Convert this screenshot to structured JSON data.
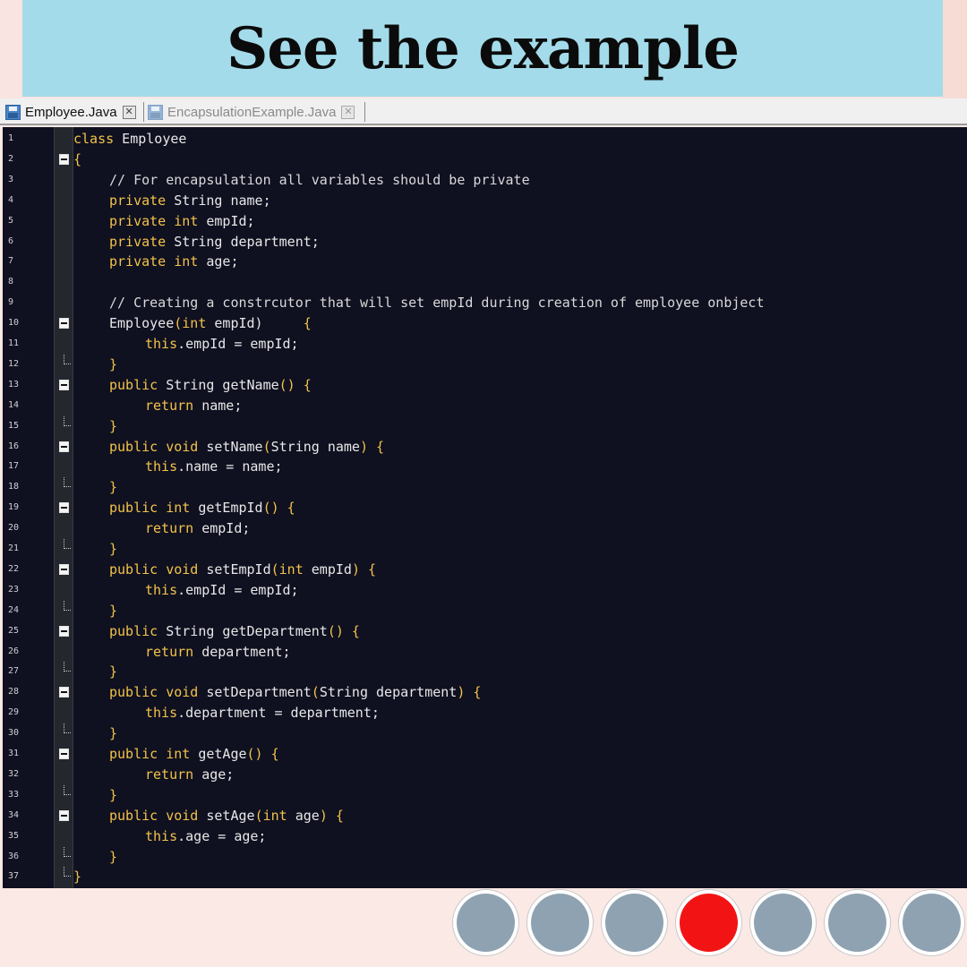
{
  "banner": {
    "title": "See the example"
  },
  "tabs": [
    {
      "label": "Employee.Java",
      "active": true
    },
    {
      "label": "EncapsulationExample.Java",
      "active": false
    }
  ],
  "editor": {
    "lines": [
      {
        "n": "1",
        "fold": "none",
        "indent": 0,
        "segs": [
          [
            "kw",
            "class"
          ],
          [
            "t",
            " Employee"
          ]
        ]
      },
      {
        "n": "2",
        "fold": "open",
        "indent": 0,
        "segs": [
          [
            "br",
            "{"
          ]
        ]
      },
      {
        "n": "3",
        "fold": "none",
        "indent": 1,
        "segs": [
          [
            "cm",
            "// For encapsulation all variables should be private"
          ]
        ]
      },
      {
        "n": "4",
        "fold": "none",
        "indent": 1,
        "segs": [
          [
            "kw",
            "private"
          ],
          [
            "t",
            " String name;"
          ]
        ]
      },
      {
        "n": "5",
        "fold": "none",
        "indent": 1,
        "segs": [
          [
            "kw",
            "private int"
          ],
          [
            "t",
            " empId;"
          ]
        ]
      },
      {
        "n": "6",
        "fold": "none",
        "indent": 1,
        "segs": [
          [
            "kw",
            "private"
          ],
          [
            "t",
            " String department;"
          ]
        ]
      },
      {
        "n": "7",
        "fold": "none",
        "indent": 1,
        "segs": [
          [
            "kw",
            "private int"
          ],
          [
            "t",
            " age;"
          ]
        ]
      },
      {
        "n": "8",
        "fold": "none",
        "indent": 1,
        "segs": []
      },
      {
        "n": "9",
        "fold": "none",
        "indent": 1,
        "segs": [
          [
            "cm",
            "// Creating a constrcutor that will set empId during creation of employee onbject"
          ]
        ]
      },
      {
        "n": "10",
        "fold": "open",
        "indent": 1,
        "segs": [
          [
            "t",
            "Employee"
          ],
          [
            "kw",
            "(int"
          ],
          [
            "t",
            " empId)"
          ],
          [
            "br",
            "     {"
          ]
        ]
      },
      {
        "n": "11",
        "fold": "none",
        "indent": 2,
        "segs": [
          [
            "kw",
            "this"
          ],
          [
            "t",
            ".empId = empId;"
          ]
        ]
      },
      {
        "n": "12",
        "fold": "end",
        "indent": 1,
        "segs": [
          [
            "br",
            "}"
          ]
        ]
      },
      {
        "n": "13",
        "fold": "open",
        "indent": 1,
        "segs": [
          [
            "kw",
            "public"
          ],
          [
            "t",
            " String getName"
          ],
          [
            "br",
            "() {"
          ]
        ]
      },
      {
        "n": "14",
        "fold": "none",
        "indent": 2,
        "segs": [
          [
            "kw",
            "return"
          ],
          [
            "t",
            " name;"
          ]
        ]
      },
      {
        "n": "15",
        "fold": "end",
        "indent": 1,
        "segs": [
          [
            "br",
            "}"
          ]
        ]
      },
      {
        "n": "16",
        "fold": "open",
        "indent": 1,
        "segs": [
          [
            "kw",
            "public void"
          ],
          [
            "t",
            " setName"
          ],
          [
            "br",
            "("
          ],
          [
            "t",
            "String name"
          ],
          [
            "br",
            ") {"
          ]
        ]
      },
      {
        "n": "17",
        "fold": "none",
        "indent": 2,
        "segs": [
          [
            "kw",
            "this"
          ],
          [
            "t",
            ".name = name;"
          ]
        ]
      },
      {
        "n": "18",
        "fold": "end",
        "indent": 1,
        "segs": [
          [
            "br",
            "}"
          ]
        ]
      },
      {
        "n": "19",
        "fold": "open",
        "indent": 1,
        "segs": [
          [
            "kw",
            "public int"
          ],
          [
            "t",
            " getEmpId"
          ],
          [
            "br",
            "() {"
          ]
        ]
      },
      {
        "n": "20",
        "fold": "none",
        "indent": 2,
        "segs": [
          [
            "kw",
            "return"
          ],
          [
            "t",
            " empId;"
          ]
        ]
      },
      {
        "n": "21",
        "fold": "end",
        "indent": 1,
        "segs": [
          [
            "br",
            "}"
          ]
        ]
      },
      {
        "n": "22",
        "fold": "open",
        "indent": 1,
        "segs": [
          [
            "kw",
            "public void"
          ],
          [
            "t",
            " setEmpId"
          ],
          [
            "kw",
            "(int"
          ],
          [
            "t",
            " empId"
          ],
          [
            "br",
            ") {"
          ]
        ]
      },
      {
        "n": "23",
        "fold": "none",
        "indent": 2,
        "segs": [
          [
            "kw",
            "this"
          ],
          [
            "t",
            ".empId = empId;"
          ]
        ]
      },
      {
        "n": "24",
        "fold": "end",
        "indent": 1,
        "segs": [
          [
            "br",
            "}"
          ]
        ]
      },
      {
        "n": "25",
        "fold": "open",
        "indent": 1,
        "segs": [
          [
            "kw",
            "public"
          ],
          [
            "t",
            " String getDepartment"
          ],
          [
            "br",
            "() {"
          ]
        ]
      },
      {
        "n": "26",
        "fold": "none",
        "indent": 2,
        "segs": [
          [
            "kw",
            "return"
          ],
          [
            "t",
            " department;"
          ]
        ]
      },
      {
        "n": "27",
        "fold": "end",
        "indent": 1,
        "segs": [
          [
            "br",
            "}"
          ]
        ]
      },
      {
        "n": "28",
        "fold": "open",
        "indent": 1,
        "segs": [
          [
            "kw",
            "public void"
          ],
          [
            "t",
            " setDepartment"
          ],
          [
            "br",
            "("
          ],
          [
            "t",
            "String department"
          ],
          [
            "br",
            ") {"
          ]
        ]
      },
      {
        "n": "29",
        "fold": "none",
        "indent": 2,
        "segs": [
          [
            "kw",
            "this"
          ],
          [
            "t",
            ".department = department;"
          ]
        ]
      },
      {
        "n": "30",
        "fold": "end",
        "indent": 1,
        "segs": [
          [
            "br",
            "}"
          ]
        ]
      },
      {
        "n": "31",
        "fold": "open",
        "indent": 1,
        "segs": [
          [
            "kw",
            "public int"
          ],
          [
            "t",
            " getAge"
          ],
          [
            "br",
            "() {"
          ]
        ]
      },
      {
        "n": "32",
        "fold": "none",
        "indent": 2,
        "segs": [
          [
            "kw",
            "return"
          ],
          [
            "t",
            " age;"
          ]
        ]
      },
      {
        "n": "33",
        "fold": "end",
        "indent": 1,
        "segs": [
          [
            "br",
            "}"
          ]
        ]
      },
      {
        "n": "34",
        "fold": "open",
        "indent": 1,
        "segs": [
          [
            "kw",
            "public void"
          ],
          [
            "t",
            " setAge"
          ],
          [
            "kw",
            "(int"
          ],
          [
            "t",
            " age"
          ],
          [
            "br",
            ") {"
          ]
        ]
      },
      {
        "n": "35",
        "fold": "none",
        "indent": 2,
        "segs": [
          [
            "kw",
            "this"
          ],
          [
            "t",
            ".age = age;"
          ]
        ]
      },
      {
        "n": "36",
        "fold": "end",
        "indent": 1,
        "segs": [
          [
            "br",
            "}"
          ]
        ]
      },
      {
        "n": "37",
        "fold": "end",
        "indent": 0,
        "segs": [
          [
            "br",
            "}"
          ]
        ]
      }
    ]
  },
  "pagination": {
    "dots": 7,
    "active_index": 3,
    "colors": {
      "inactive": "#8fa2b2",
      "active": "#f21414"
    }
  }
}
